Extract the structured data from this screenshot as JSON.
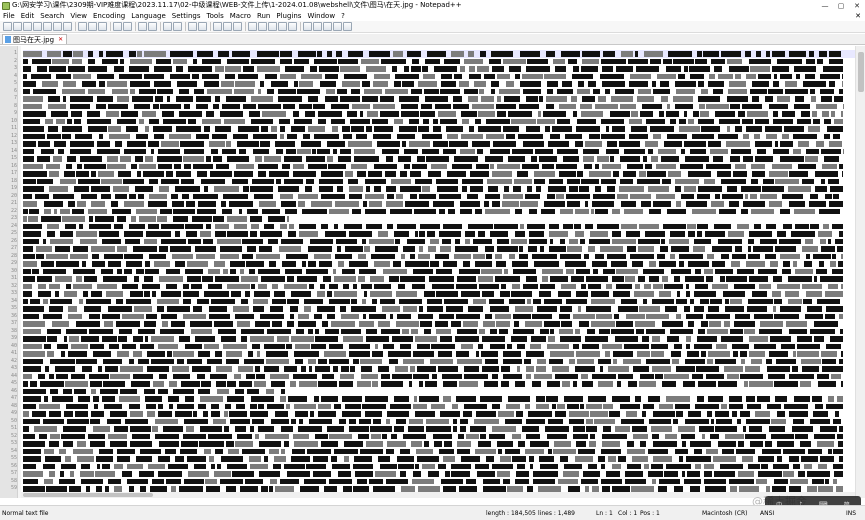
{
  "window": {
    "title": "G:\\网安学习\\课件\\2309期-VIP难度课程\\2023.11.17\\02-中级课程\\WEB-文件上传\\1-2024.01.08\\webshell\\文件\\图马\\在天.jpg - Notepad++",
    "controls": {
      "minimize": "—",
      "maximize": "▢",
      "close": "✕"
    }
  },
  "menu": {
    "items": [
      "File",
      "Edit",
      "Search",
      "View",
      "Encoding",
      "Language",
      "Settings",
      "Tools",
      "Macro",
      "Run",
      "Plugins",
      "Window",
      "?"
    ],
    "right_action": "✕"
  },
  "tab": {
    "label": "图马在天.jpg",
    "close": "✕"
  },
  "status": {
    "file_type": "Normal text file",
    "length": "length : 184,505",
    "lines": "lines : 1,489",
    "line_pos": "Ln : 1",
    "col": "Col : 1",
    "pos": "Pos : 1",
    "eol": "Macintosh (CR)",
    "encoding": "ANSI",
    "ins": "INS"
  },
  "overlay": {
    "watermark": "@稀土掘金",
    "tray": [
      "中",
      "♪",
      "⌨",
      "简"
    ]
  },
  "colors": {
    "accent": "#5aa0e6",
    "null_block": "#111111",
    "gutter": "#e4e4e4"
  }
}
